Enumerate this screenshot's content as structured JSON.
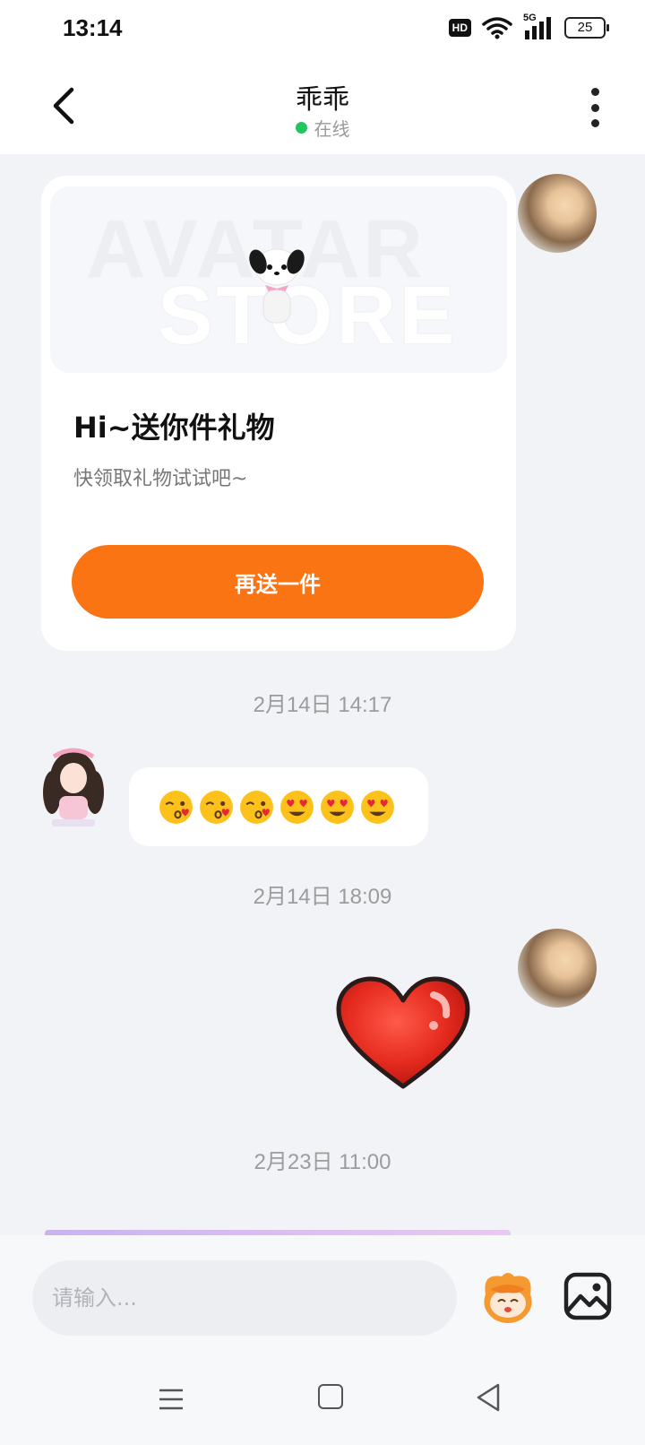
{
  "status_bar": {
    "time": "13:14",
    "hd": "HD",
    "network": "5G",
    "battery": "25"
  },
  "header": {
    "title": "乖乖",
    "status": "在线"
  },
  "gift_card": {
    "banner_watermark_1": "AVATAR",
    "banner_watermark_2": "STORE",
    "title": "Hi~送你件礼物",
    "subtitle": "快领取礼物试试吧~",
    "button_label": "再送一件"
  },
  "messages": [
    {
      "timestamp": "2月14日 14:17",
      "side": "left",
      "type": "emoji",
      "content": [
        "kissing-wink",
        "kissing-wink",
        "kissing-wink",
        "heart-eyes",
        "heart-eyes",
        "heart-eyes"
      ]
    },
    {
      "timestamp": "2月14日 18:09",
      "side": "right",
      "type": "sticker",
      "content": "red-heart-sticker"
    },
    {
      "timestamp": "2月23日 11:00"
    }
  ],
  "input": {
    "placeholder": "请输入..."
  },
  "colors": {
    "accent": "#fb7414",
    "online": "#22c55e",
    "background": "#f2f3f7"
  },
  "icons": [
    "back-arrow-icon",
    "more-vertical-icon",
    "wifi-icon",
    "signal-icon",
    "mascot-icon",
    "image-icon"
  ]
}
